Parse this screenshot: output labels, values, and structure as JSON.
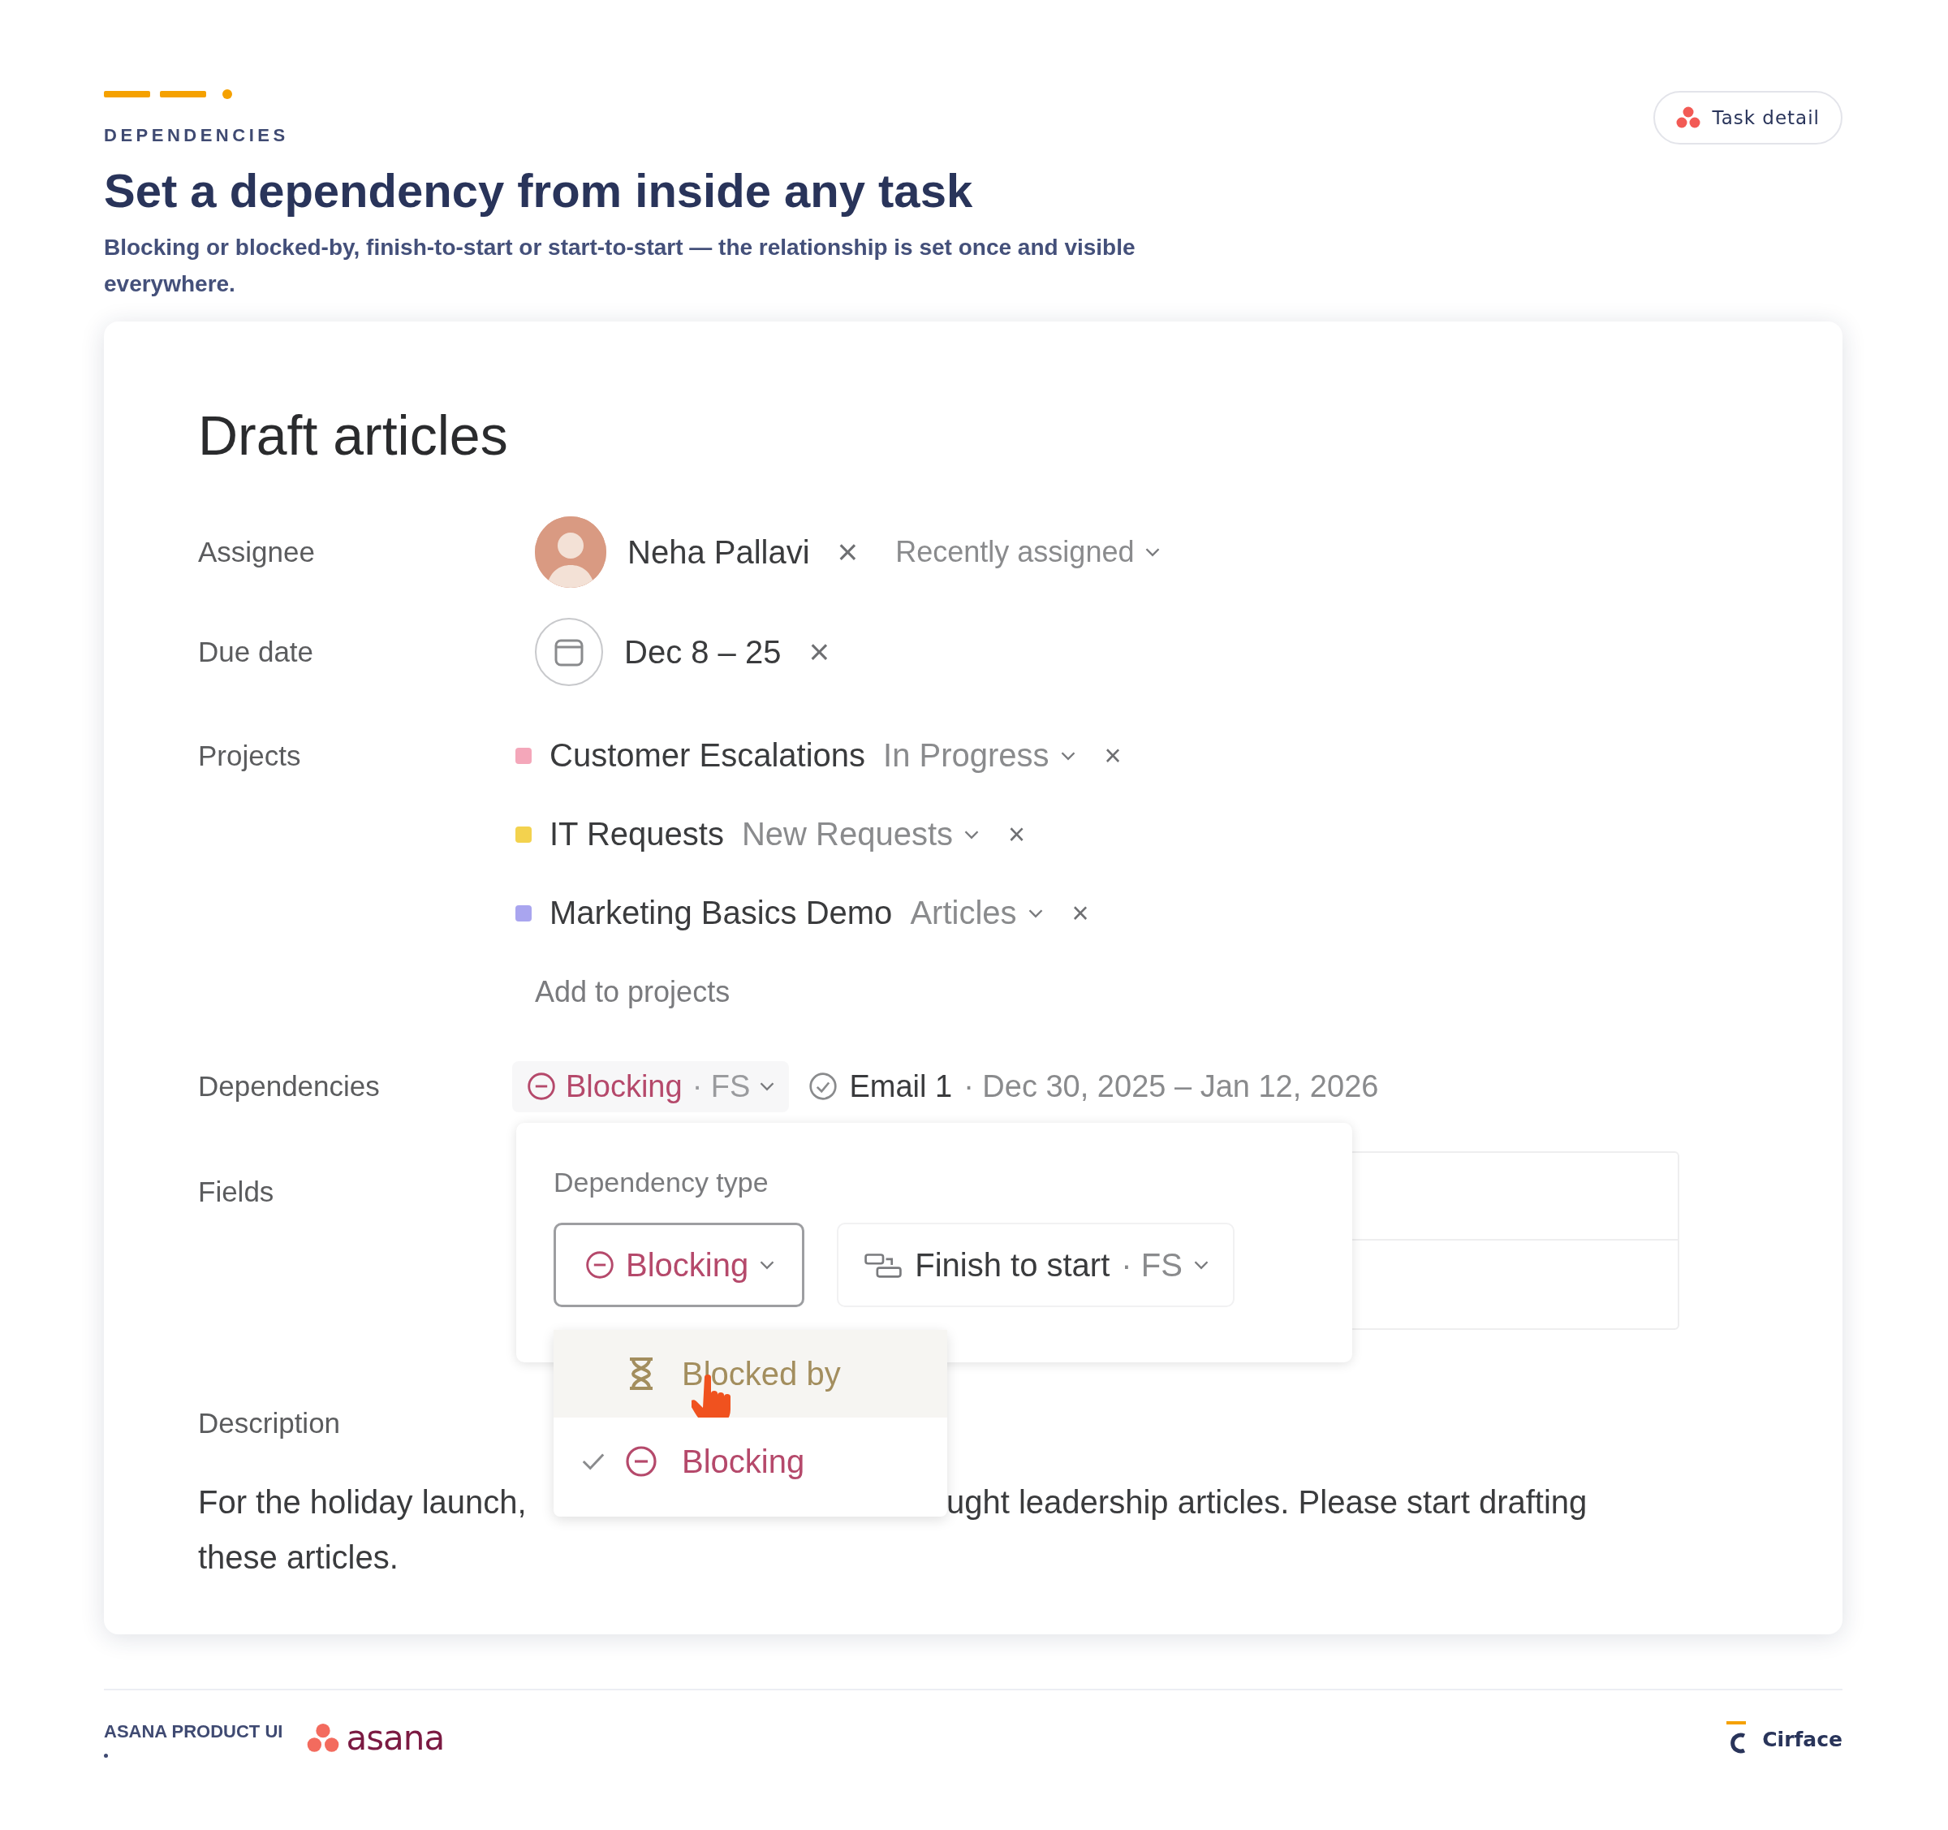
{
  "header": {
    "eyebrow": "DEPENDENCIES",
    "title": "Set a dependency from inside any task",
    "subtitle": "Blocking or blocked-by, finish-to-start or start-to-start — the relationship is set once and visible everywhere.",
    "badge": "Task detail"
  },
  "task": {
    "title": "Draft articles",
    "assignee": {
      "label": "Assignee",
      "name": "Neha Pallavi",
      "remove": "×",
      "option": "Recently assigned"
    },
    "due_date": {
      "label": "Due date",
      "value": "Dec 8 – 25",
      "remove": "×"
    },
    "projects": {
      "label": "Projects",
      "items": [
        {
          "name": "Customer Escalations",
          "section": "In Progress",
          "remove": "×",
          "color": "#f4a7ba"
        },
        {
          "name": "IT Requests",
          "section": "New Requests",
          "remove": "×",
          "color": "#f3d24e"
        },
        {
          "name": "Marketing Basics Demo",
          "section": "Articles",
          "remove": "×",
          "color": "#a9a5ef"
        }
      ],
      "add": "Add to projects"
    },
    "dependencies": {
      "label": "Dependencies",
      "type": "Blocking",
      "code": "· FS",
      "task": "Email 1",
      "dates": "· Dec 30, 2025 – Jan 12, 2026"
    },
    "fields": {
      "label": "Fields"
    },
    "popover": {
      "title": "Dependency type",
      "type_button": "Blocking",
      "timing_button": "Finish to start",
      "timing_code": "· FS"
    },
    "menu": {
      "items": [
        {
          "label": "Blocked by",
          "kind": "blocked-by",
          "hovered": true,
          "selected": false
        },
        {
          "label": "Blocking",
          "kind": "blocking",
          "hovered": false,
          "selected": true
        }
      ]
    },
    "description": {
      "label": "Description",
      "parts": [
        "For the holiday launch,",
        "ught leadership articles. Please start drafting",
        "these articles."
      ]
    }
  },
  "footer": {
    "label": "ASANA PRODUCT UI",
    "logo": "asana",
    "brand": "Cirface"
  }
}
